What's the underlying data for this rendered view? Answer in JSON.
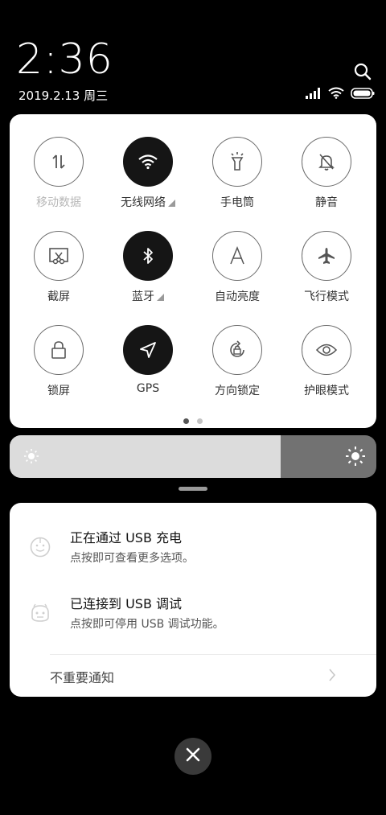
{
  "status": {
    "time": "2:36",
    "date": "2019.2.13 周三"
  },
  "quick_settings": {
    "row1": [
      {
        "label": "移动数据",
        "icon": "mobile-data-icon",
        "active": false,
        "dimmed": true
      },
      {
        "label": "无线网络",
        "icon": "wifi-icon",
        "active": true
      },
      {
        "label": "手电筒",
        "icon": "flashlight-icon",
        "active": false
      },
      {
        "label": "静音",
        "icon": "mute-bell-icon",
        "active": false
      }
    ],
    "row2": [
      {
        "label": "截屏",
        "icon": "screenshot-icon",
        "active": false
      },
      {
        "label": "蓝牙",
        "icon": "bluetooth-icon",
        "active": true
      },
      {
        "label": "自动亮度",
        "icon": "auto-brightness-icon",
        "active": false
      },
      {
        "label": "飞行模式",
        "icon": "airplane-icon",
        "active": false
      }
    ],
    "row3": [
      {
        "label": "锁屏",
        "icon": "lock-icon",
        "active": false
      },
      {
        "label": "GPS",
        "icon": "gps-icon",
        "active": true
      },
      {
        "label": "方向锁定",
        "icon": "rotation-lock-icon",
        "active": false
      },
      {
        "label": "护眼模式",
        "icon": "eye-icon",
        "active": false
      }
    ],
    "page_count": 2,
    "current_page": 1
  },
  "brightness": {
    "level": 0.74
  },
  "notifications": [
    {
      "title": "正在通过 USB 充电",
      "text": "点按即可查看更多选项。",
      "icon": "usb-charging-icon"
    },
    {
      "title": "已连接到 USB 调试",
      "text": "点按即可停用 USB 调试功能。",
      "icon": "android-debug-icon"
    }
  ],
  "unimportant_label": "不重要通知",
  "colors": {
    "active_tile": "#151515",
    "panel_bg": "#ffffff",
    "brightness_fill": "#dcdcdc",
    "brightness_track": "#727272"
  }
}
